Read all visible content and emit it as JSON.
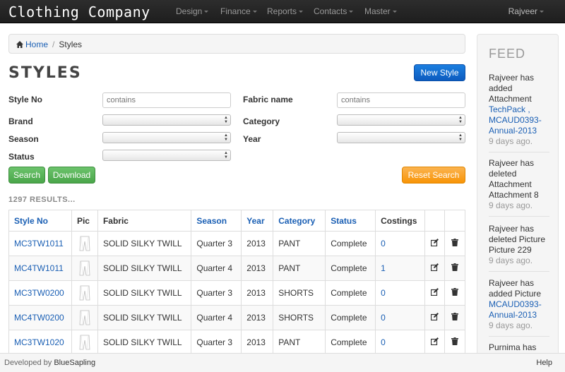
{
  "navbar": {
    "brand": "Clothing Company",
    "items": [
      {
        "label": "Design"
      },
      {
        "label": "Finance"
      },
      {
        "label": "Reports"
      },
      {
        "label": "Contacts"
      },
      {
        "label": "Master"
      }
    ],
    "user": "Rajveer"
  },
  "breadcrumb": {
    "home": "Home",
    "sep": "/",
    "current": "Styles"
  },
  "page": {
    "title": "STYLES",
    "new_button": "New Style"
  },
  "filters": {
    "style_no": {
      "label": "Style No",
      "placeholder": "contains"
    },
    "fabric_name": {
      "label": "Fabric name",
      "placeholder": "contains"
    },
    "brand": {
      "label": "Brand"
    },
    "category": {
      "label": "Category"
    },
    "season": {
      "label": "Season"
    },
    "year": {
      "label": "Year"
    },
    "status": {
      "label": "Status"
    },
    "search_button": "Search",
    "download_button": "Download",
    "reset_button": "Reset Search"
  },
  "results": {
    "text": "1297 RESULTS..."
  },
  "table": {
    "headers": {
      "style_no": "Style No",
      "pic": "Pic",
      "fabric": "Fabric",
      "season": "Season",
      "year": "Year",
      "category": "Category",
      "status": "Status",
      "costings": "Costings"
    },
    "rows": [
      {
        "style_no": "MC3TW1011",
        "fabric": "SOLID SILKY TWILL",
        "season": "Quarter 3",
        "year": "2013",
        "category": "PANT",
        "status": "Complete",
        "costings": "0"
      },
      {
        "style_no": "MC4TW1011",
        "fabric": "SOLID SILKY TWILL",
        "season": "Quarter 4",
        "year": "2013",
        "category": "PANT",
        "status": "Complete",
        "costings": "1"
      },
      {
        "style_no": "MC3TW0200",
        "fabric": "SOLID SILKY TWILL",
        "season": "Quarter 3",
        "year": "2013",
        "category": "SHORTS",
        "status": "Complete",
        "costings": "0"
      },
      {
        "style_no": "MC4TW0200",
        "fabric": "SOLID SILKY TWILL",
        "season": "Quarter 4",
        "year": "2013",
        "category": "SHORTS",
        "status": "Complete",
        "costings": "0"
      },
      {
        "style_no": "MC3TW1020",
        "fabric": "SOLID SILKY TWILL",
        "season": "Quarter 3",
        "year": "2013",
        "category": "PANT",
        "status": "Complete",
        "costings": "0"
      }
    ],
    "icons": {
      "edit": "edit-icon",
      "delete": "trash-icon"
    }
  },
  "feed": {
    "title": "FEED",
    "items": [
      {
        "text": "Rajveer has added Attachment",
        "link": "TechPack , MCAUD0393-Annual-2013",
        "ago": "9 days ago."
      },
      {
        "text": "Rajveer has deleted Attachment Attachment 8",
        "link": "",
        "ago": "9 days ago."
      },
      {
        "text": "Rajveer has deleted Picture Picture 229",
        "link": "",
        "ago": "9 days ago."
      },
      {
        "text": "Rajveer has added Picture",
        "link": "MCAUD0393-Annual-2013",
        "ago": "9 days ago."
      },
      {
        "text": "Purnima has",
        "link": "",
        "ago": ""
      }
    ]
  },
  "footer": {
    "developed_by": "Developed by",
    "company": "BlueSapling",
    "help": "Help"
  },
  "colors": {
    "primary": "#0d5bbf",
    "success": "#4aa64a",
    "warning": "#f89406",
    "link": "#1a5fb4"
  }
}
